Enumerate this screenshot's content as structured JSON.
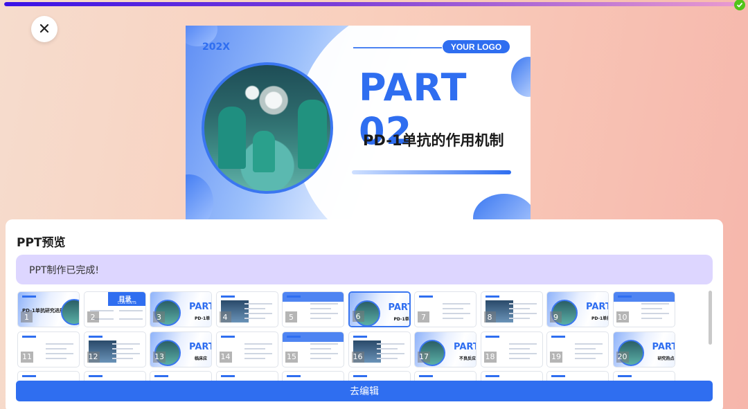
{
  "progress": {
    "percent": 100
  },
  "slide": {
    "year": "202X",
    "logo": "YOUR LOGO",
    "part_title": "PART 02",
    "subtitle": "PD-1单抗的作用机制"
  },
  "panel": {
    "title": "PPT预览",
    "status": "PPT制作已完成!",
    "edit_button": "去编辑"
  },
  "thumbnails": [
    {
      "num": "1",
      "text": "PD-1单抗研究进展"
    },
    {
      "num": "2",
      "text": "目录",
      "sub": "CONTENTS"
    },
    {
      "num": "3",
      "part": "PART",
      "sub": "PD-1单"
    },
    {
      "num": "4"
    },
    {
      "num": "5"
    },
    {
      "num": "6",
      "part": "PART",
      "sub": "PD-1单抗的作",
      "active": true
    },
    {
      "num": "7"
    },
    {
      "num": "8"
    },
    {
      "num": "9",
      "part": "PART",
      "sub": "PD-1单抗启研"
    },
    {
      "num": "10"
    },
    {
      "num": "11"
    },
    {
      "num": "12"
    },
    {
      "num": "13",
      "part": "PART",
      "sub": "临床应"
    },
    {
      "num": "14"
    },
    {
      "num": "15"
    },
    {
      "num": "16"
    },
    {
      "num": "17",
      "part": "PART",
      "sub": "不良反应"
    },
    {
      "num": "18"
    },
    {
      "num": "19"
    },
    {
      "num": "20",
      "part": "PART",
      "sub": "研究热点与未"
    }
  ],
  "colors": {
    "accent": "#2f6ef0",
    "status_bg": "#ddd6ff",
    "success": "#52c41a"
  },
  "icons": {
    "close": "close-icon",
    "done": "check-circle-icon"
  }
}
